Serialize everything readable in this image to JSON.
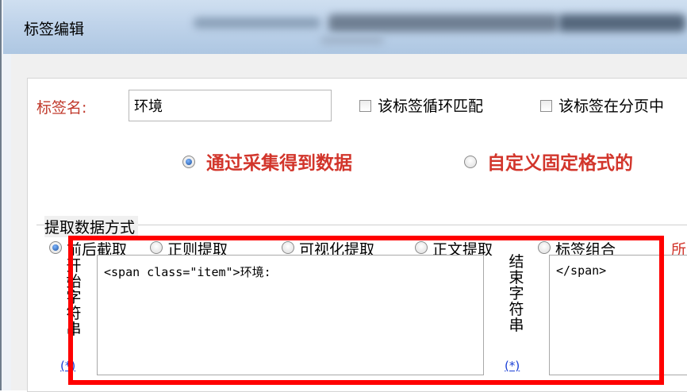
{
  "window": {
    "title": "标签编辑"
  },
  "tag_name": {
    "label": "标签名:",
    "value": "环境"
  },
  "options": {
    "loop_match": "该标签循环匹配",
    "in_page": "该标签在分页中"
  },
  "data_source": {
    "option1": "通过采集得到数据",
    "option2": "自定义固定格式的"
  },
  "extract": {
    "group_title": "提取数据方式",
    "modes": [
      "前后截取",
      "正则提取",
      "可视化提取",
      "正文提取",
      "标签组合"
    ],
    "trailing": "所"
  },
  "start_string": {
    "label": "开始字符串",
    "star": "(*)",
    "value": "<span class=\"item\">环境:"
  },
  "end_string": {
    "label": "结束字符串",
    "star": "(*)",
    "value": "</span>"
  },
  "colors": {
    "accent_red": "#d2352b",
    "highlight": "#ff0000",
    "link_blue": "#1a3fd6"
  }
}
